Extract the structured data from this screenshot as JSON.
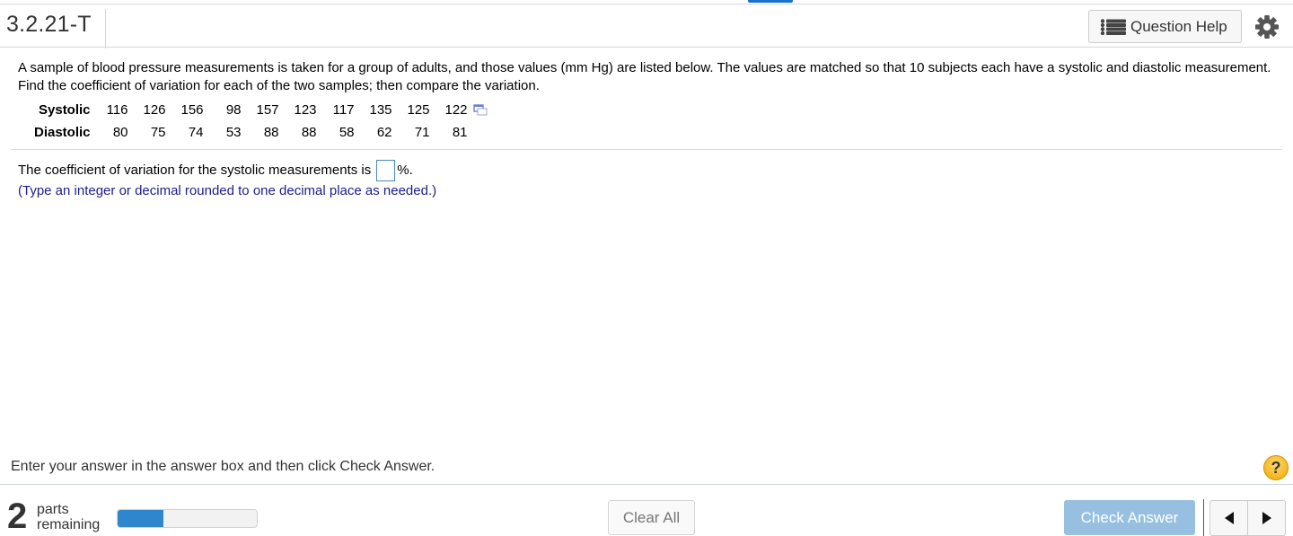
{
  "header": {
    "question_id": "3.2.21-T",
    "help_button_label": "Question Help",
    "help_icon": "list-icon",
    "settings_icon": "gear-icon"
  },
  "question": {
    "text": "A sample of blood pressure measurements is taken for a group of adults, and those values (mm Hg) are listed below. The values are matched so that 10 subjects each have a systolic and diastolic measurement. Find the coefficient of variation for each of the two samples; then compare the variation.",
    "table": {
      "rows": [
        {
          "label": "Systolic",
          "values": [
            "116",
            "126",
            "156",
            "98",
            "157",
            "123",
            "117",
            "135",
            "125",
            "122"
          ]
        },
        {
          "label": "Diastolic",
          "values": [
            "80",
            "75",
            "74",
            "53",
            "88",
            "88",
            "58",
            "62",
            "71",
            "81"
          ]
        }
      ],
      "copy_icon": "copy-data-icon"
    }
  },
  "answer": {
    "prompt_before": "The coefficient of variation for the systolic measurements is",
    "prompt_after": "%.",
    "value": "",
    "hint": "(Type an integer or decimal rounded to one decimal place as needed.)"
  },
  "footer": {
    "instruction": "Enter your answer in the answer box and then click Check Answer.",
    "help_symbol": "?",
    "parts_count": "2",
    "parts_label_line1": "parts",
    "parts_label_line2": "remaining",
    "progress_percent": 33,
    "clear_all_label": "Clear All",
    "check_answer_label": "Check Answer",
    "prev_icon": "triangle-left-icon",
    "next_icon": "triangle-right-icon"
  },
  "colors": {
    "accent_blue": "#2f86cd",
    "check_answer_disabled": "#97c0e0",
    "hint_text": "#1d1d8c",
    "help_yellow": "#f0a800"
  }
}
